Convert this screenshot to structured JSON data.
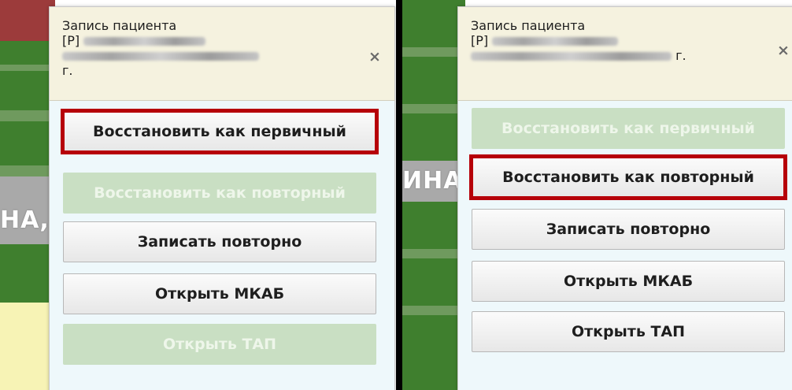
{
  "left_dialog": {
    "title_line1": "Запись пациента",
    "title_line2_prefix": "[Р]",
    "title_line3_suffix": "г.",
    "close": "×",
    "buttons": {
      "restore_primary": "Восстановить как первичный",
      "restore_repeat": "Восстановить как повторный",
      "record_again": "Записать повторно",
      "open_mkab": "Открыть МКАБ",
      "open_tap": "Открыть ТАП"
    },
    "background_text": "НА,"
  },
  "right_dialog": {
    "title_line1": "Запись пациента",
    "title_line2_prefix": "[Р]",
    "title_line3_suffix": "г.",
    "close": "×",
    "buttons": {
      "restore_primary": "Восстановить как первичный",
      "restore_repeat": "Восстановить как повторный",
      "record_again": "Записать повторно",
      "open_mkab": "Открыть МКАБ",
      "open_tap": "Открыть ТАП"
    },
    "background_text": "ИНА"
  },
  "colors": {
    "highlight": "#b60009",
    "disabled_button": "#c9dfc3",
    "header_bg": "#f5f2df",
    "popup_bg": "#eef8fb"
  }
}
